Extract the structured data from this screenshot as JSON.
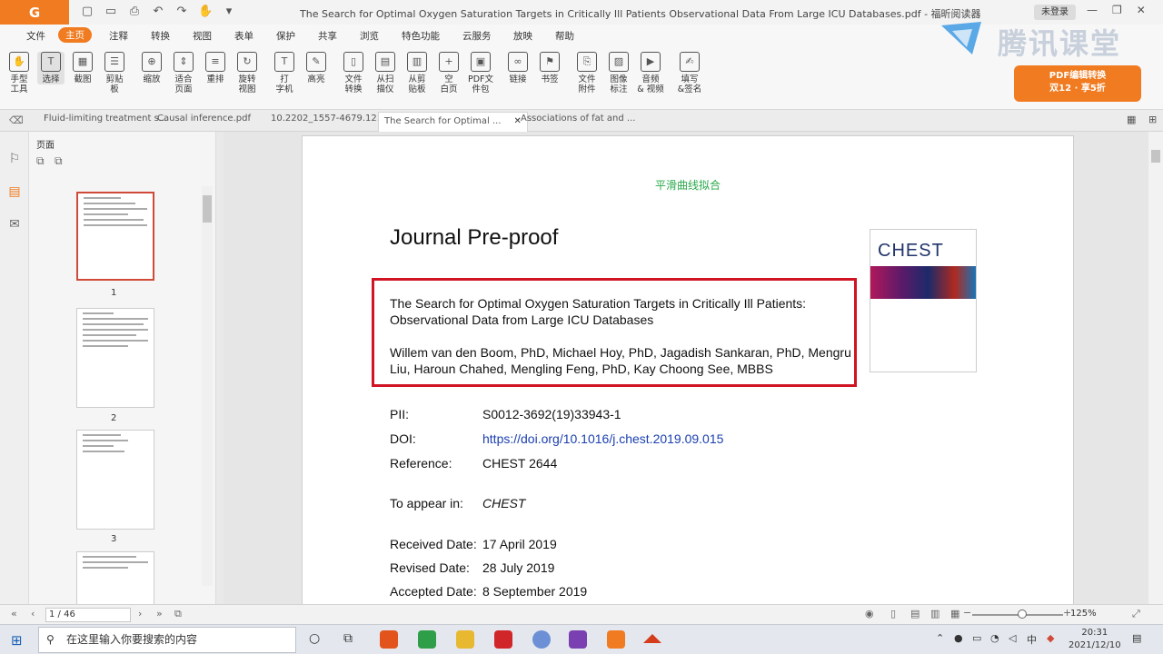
{
  "window": {
    "title": "The Search for Optimal Oxygen Saturation Targets in Critically Ill Patients Observational Data From Large ICU Databases.pdf - 福昕阅读器",
    "login": "未登录"
  },
  "menu": [
    "文件",
    "主页",
    "注释",
    "转换",
    "视图",
    "表单",
    "保护",
    "共享",
    "浏览",
    "特色功能",
    "云服务",
    "放映",
    "帮助"
  ],
  "ribbon": [
    {
      "label": "手型\n工具",
      "icon": "hand-icon"
    },
    {
      "label": "选择",
      "icon": "text-select-icon"
    },
    {
      "label": "截图",
      "icon": "screenshot-icon"
    },
    {
      "label": "剪贴\n板",
      "icon": "clipboard-icon"
    },
    {
      "label": "缩放",
      "icon": "zoom-icon"
    },
    {
      "label": "适合\n页面",
      "icon": "fit-page-icon"
    },
    {
      "label": "重排",
      "icon": "reflow-icon"
    },
    {
      "label": "旋转\n视图",
      "icon": "rotate-icon"
    },
    {
      "label": "打\n字机",
      "icon": "typewriter-icon"
    },
    {
      "label": "高亮",
      "icon": "highlight-icon"
    },
    {
      "label": "文件\n转换",
      "icon": "convert-icon"
    },
    {
      "label": "从扫\n描仪",
      "icon": "scanner-icon"
    },
    {
      "label": "从剪\n贴板",
      "icon": "from-clipboard-icon"
    },
    {
      "label": "空\n白页",
      "icon": "blank-page-icon"
    },
    {
      "label": "PDF文\n件包",
      "icon": "portfolio-icon"
    },
    {
      "label": "链接",
      "icon": "link-icon"
    },
    {
      "label": "书签",
      "icon": "bookmark-icon"
    },
    {
      "label": "文件\n附件",
      "icon": "attachment-icon"
    },
    {
      "label": "图像\n标注",
      "icon": "image-annotation-icon"
    },
    {
      "label": "音频\n& 视频",
      "icon": "video-icon"
    },
    {
      "label": "填写\n&签名",
      "icon": "sign-icon"
    }
  ],
  "brand": {
    "name": "腾讯课堂",
    "promo_line1": "PDF编辑转换",
    "promo_line2": "双12 · 享5折"
  },
  "tabs": [
    "Fluid-limiting treatment s...",
    "Causal inference.pdf",
    "10.2202_1557-4679.12...",
    "The Search for Optimal ...",
    "Associations of fat and ..."
  ],
  "panel": {
    "title": "页面",
    "pages": [
      "1",
      "2",
      "3"
    ]
  },
  "document": {
    "top_note": "平滑曲线拟合",
    "heading": "Journal Pre-proof",
    "title_line1": "The Search for Optimal Oxygen Saturation Targets in Critically Ill Patients:",
    "title_line2": "Observational Data from Large ICU Databases",
    "authors_line1": "Willem van den Boom, PhD, Michael Hoy, PhD, Jagadish Sankaran, PhD, Mengru",
    "authors_line2": "Liu, Haroun Chahed, Mengling Feng, PhD, Kay Choong See, MBBS",
    "cover_title": "CHEST",
    "meta": [
      {
        "label": "PII:",
        "value": "S0012-3692(19)33943-1"
      },
      {
        "label": "DOI:",
        "value": "https://doi.org/10.1016/j.chest.2019.09.015"
      },
      {
        "label": "Reference:",
        "value": "CHEST 2644"
      },
      {
        "label": "To appear in:",
        "value": "CHEST"
      },
      {
        "label": "Received Date:",
        "value": "17 April 2019"
      },
      {
        "label": "Revised Date:",
        "value": "28 July 2019"
      },
      {
        "label": "Accepted Date:",
        "value": "8 September 2019"
      }
    ]
  },
  "status": {
    "page_indicator": "1 / 46",
    "zoom": "125%"
  },
  "taskbar": {
    "search_placeholder": "在这里输入你要搜索的内容",
    "time": "20:31",
    "date": "2021/12/10"
  }
}
